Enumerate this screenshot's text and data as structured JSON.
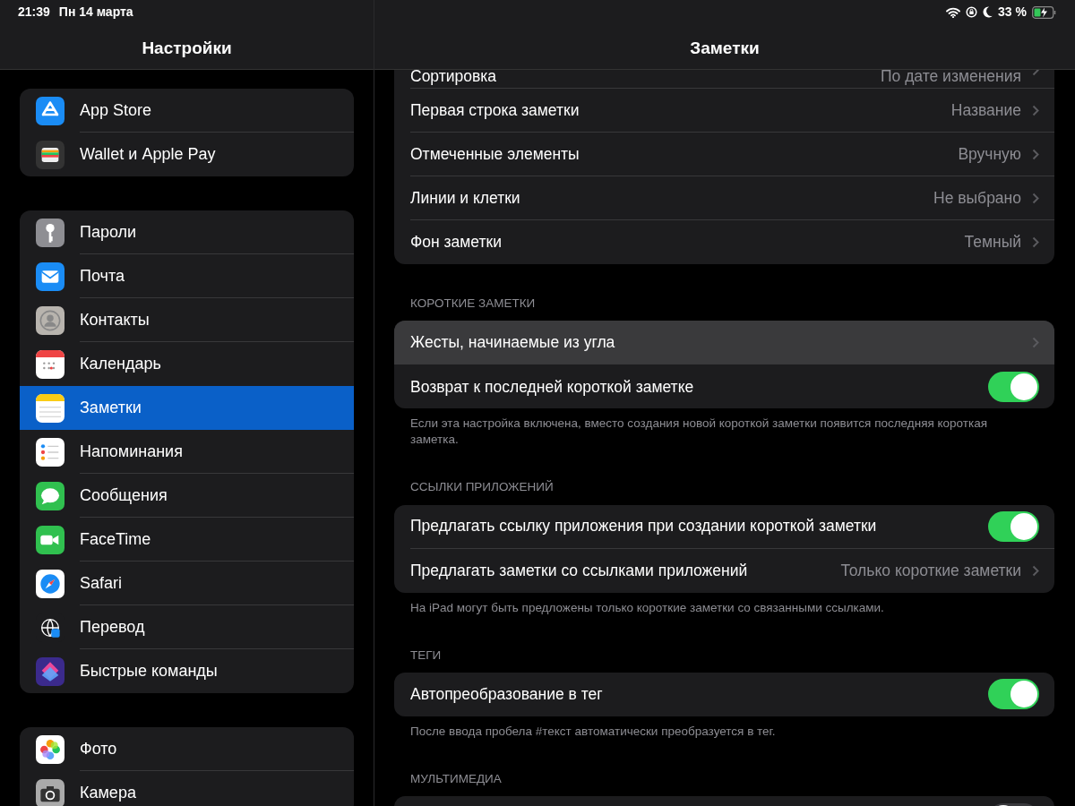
{
  "status_bar": {
    "time": "21:39",
    "date": "Пн 14 марта",
    "battery": "33 %"
  },
  "sidebar": {
    "title": "Настройки",
    "groups": [
      [
        {
          "label": "App Store",
          "selected": false
        },
        {
          "label": "Wallet и Apple Pay",
          "selected": false
        }
      ],
      [
        {
          "label": "Пароли",
          "selected": false
        },
        {
          "label": "Почта",
          "selected": false
        },
        {
          "label": "Контакты",
          "selected": false
        },
        {
          "label": "Календарь",
          "selected": false
        },
        {
          "label": "Заметки",
          "selected": true
        },
        {
          "label": "Напоминания",
          "selected": false
        },
        {
          "label": "Сообщения",
          "selected": false
        },
        {
          "label": "FaceTime",
          "selected": false
        },
        {
          "label": "Safari",
          "selected": false
        },
        {
          "label": "Перевод",
          "selected": false
        },
        {
          "label": "Быстрые команды",
          "selected": false
        }
      ],
      [
        {
          "label": "Фото",
          "selected": false
        },
        {
          "label": "Камера",
          "selected": false
        }
      ]
    ]
  },
  "detail": {
    "title": "Заметки",
    "sections": [
      {
        "rows": [
          {
            "kind": "value",
            "label": "Сортировка",
            "value": "По дате изменения",
            "selected": false
          },
          {
            "kind": "value",
            "label": "Первая строка заметки",
            "value": "Название",
            "selected": false
          },
          {
            "kind": "value",
            "label": "Отмеченные элементы",
            "value": "Вручную",
            "selected": false
          },
          {
            "kind": "value",
            "label": "Линии и клетки",
            "value": "Не выбрано",
            "selected": false
          },
          {
            "kind": "value",
            "label": "Фон заметки",
            "value": "Темный",
            "selected": false
          }
        ]
      },
      {
        "header": "КОРОТКИЕ ЗАМЕТКИ",
        "rows": [
          {
            "kind": "link",
            "label": "Жесты, начинаемые из угла",
            "selected": true
          },
          {
            "kind": "toggle",
            "label": "Возврат к последней короткой заметке",
            "on": true,
            "selected": false
          }
        ],
        "footer": "Если эта настройка включена, вместо создания новой короткой заметки появится последняя короткая заметка."
      },
      {
        "header": "ССЫЛКИ ПРИЛОЖЕНИЙ",
        "rows": [
          {
            "kind": "toggle",
            "label": "Предлагать ссылку приложения при создании короткой заметки",
            "on": true,
            "selected": false
          },
          {
            "kind": "value",
            "label": "Предлагать заметки со ссылками приложений",
            "value": "Только короткие заметки",
            "selected": false
          }
        ],
        "footer": "На iPad могут быть предложены только короткие заметки со связанными ссылками."
      },
      {
        "header": "ТЕГИ",
        "rows": [
          {
            "kind": "toggle",
            "label": "Автопреобразование в тег",
            "on": true,
            "selected": false
          }
        ],
        "footer": "После ввода пробела #текст автоматически преобразуется в тег."
      },
      {
        "header": "МУЛЬТИМЕДИА",
        "rows": [
          {
            "kind": "toggle",
            "on": false,
            "selected": false
          }
        ]
      }
    ]
  }
}
